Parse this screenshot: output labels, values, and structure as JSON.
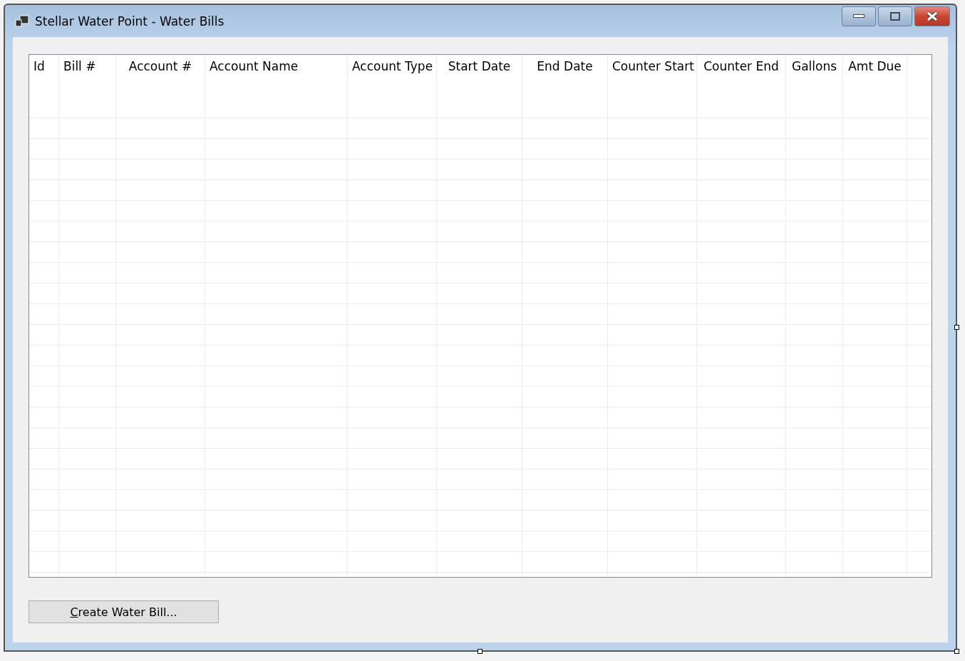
{
  "window": {
    "title": "Stellar Water Point - Water Bills"
  },
  "table": {
    "columns": [
      {
        "label": "Id"
      },
      {
        "label": "Bill #"
      },
      {
        "label": "Account #"
      },
      {
        "label": "Account Name"
      },
      {
        "label": "Account Type"
      },
      {
        "label": "Start Date"
      },
      {
        "label": "End Date"
      },
      {
        "label": "Counter Start"
      },
      {
        "label": "Counter End"
      },
      {
        "label": "Gallons"
      },
      {
        "label": "Amt Due"
      }
    ]
  },
  "buttons": [
    {
      "label": "Create Water Bill..."
    }
  ]
}
